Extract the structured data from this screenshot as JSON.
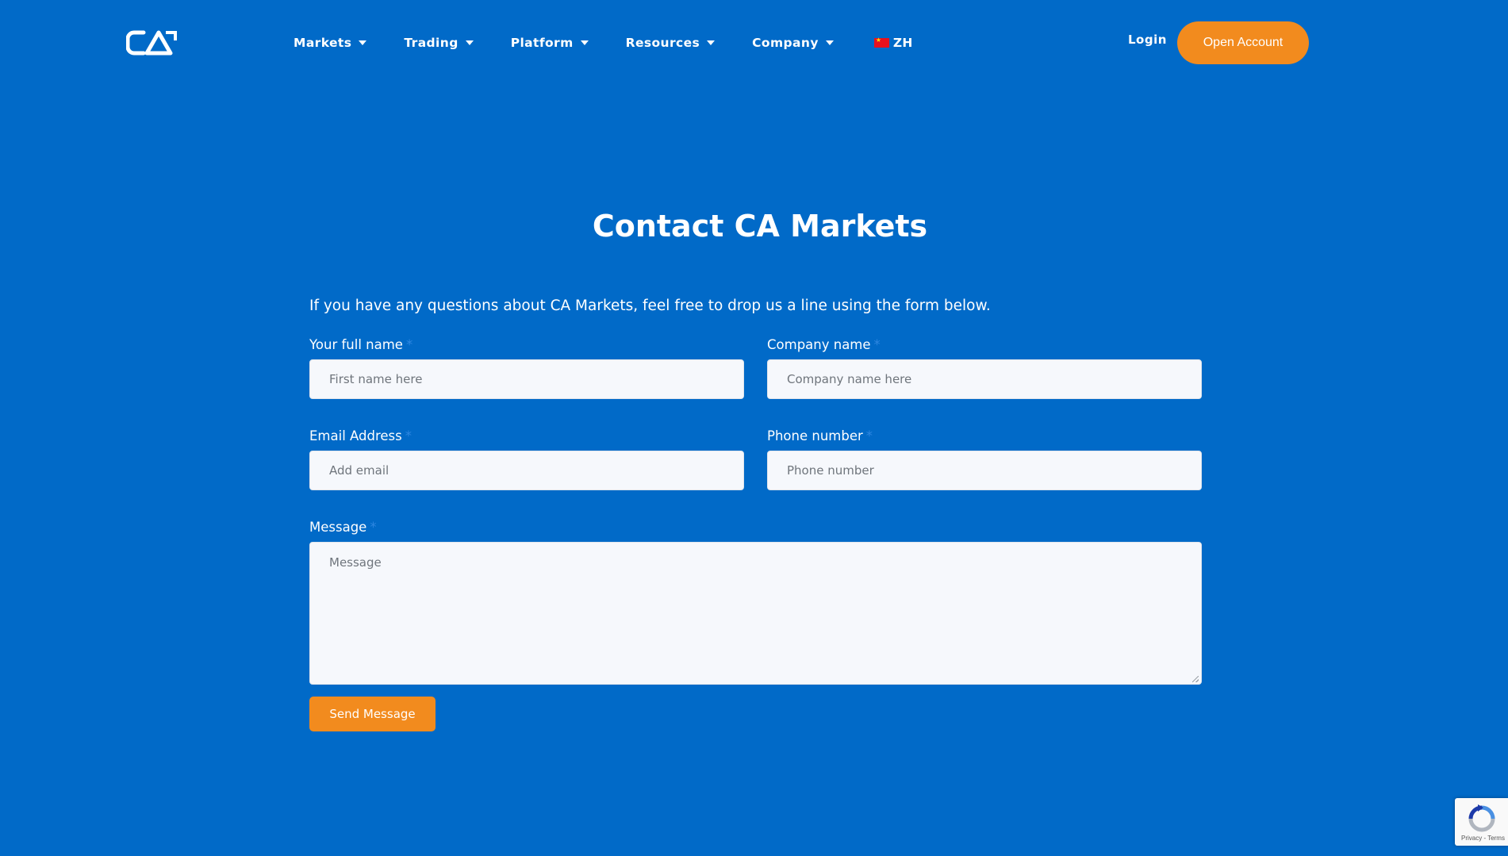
{
  "header": {
    "logo_text": "CA",
    "nav": [
      {
        "label": "Markets"
      },
      {
        "label": "Trading"
      },
      {
        "label": "Platform"
      },
      {
        "label": "Resources"
      },
      {
        "label": "Company"
      }
    ],
    "language": "ZH",
    "login_label": "Login",
    "open_account_label": "Open Account"
  },
  "main": {
    "title": "Contact CA Markets",
    "intro": "If you have any questions about CA Markets, feel free to drop us a line using the form below.",
    "form": {
      "full_name": {
        "label": "Your full name",
        "required_mark": "*",
        "placeholder": "First name here",
        "value": ""
      },
      "company": {
        "label": "Company name",
        "required_mark": "*",
        "placeholder": "Company name here",
        "value": ""
      },
      "email": {
        "label": "Email Address",
        "required_mark": "*",
        "placeholder": "Add email",
        "value": ""
      },
      "phone": {
        "label": "Phone number",
        "required_mark": "*",
        "placeholder": "Phone number",
        "value": ""
      },
      "message": {
        "label": "Message",
        "required_mark": "*",
        "placeholder": "Message",
        "value": ""
      },
      "submit_label": "Send Message"
    }
  },
  "recaptcha": {
    "links": "Privacy - Terms"
  },
  "colors": {
    "background": "#016ac8",
    "accent": "#f28b1e",
    "input_bg": "#f6f8fc",
    "required_mark": "#2e86e0"
  },
  "icons": {
    "logo": "ca-logo",
    "nav_caret": "caret-down-icon",
    "language_flag": "china-flag-icon",
    "recaptcha": "recaptcha-icon"
  }
}
